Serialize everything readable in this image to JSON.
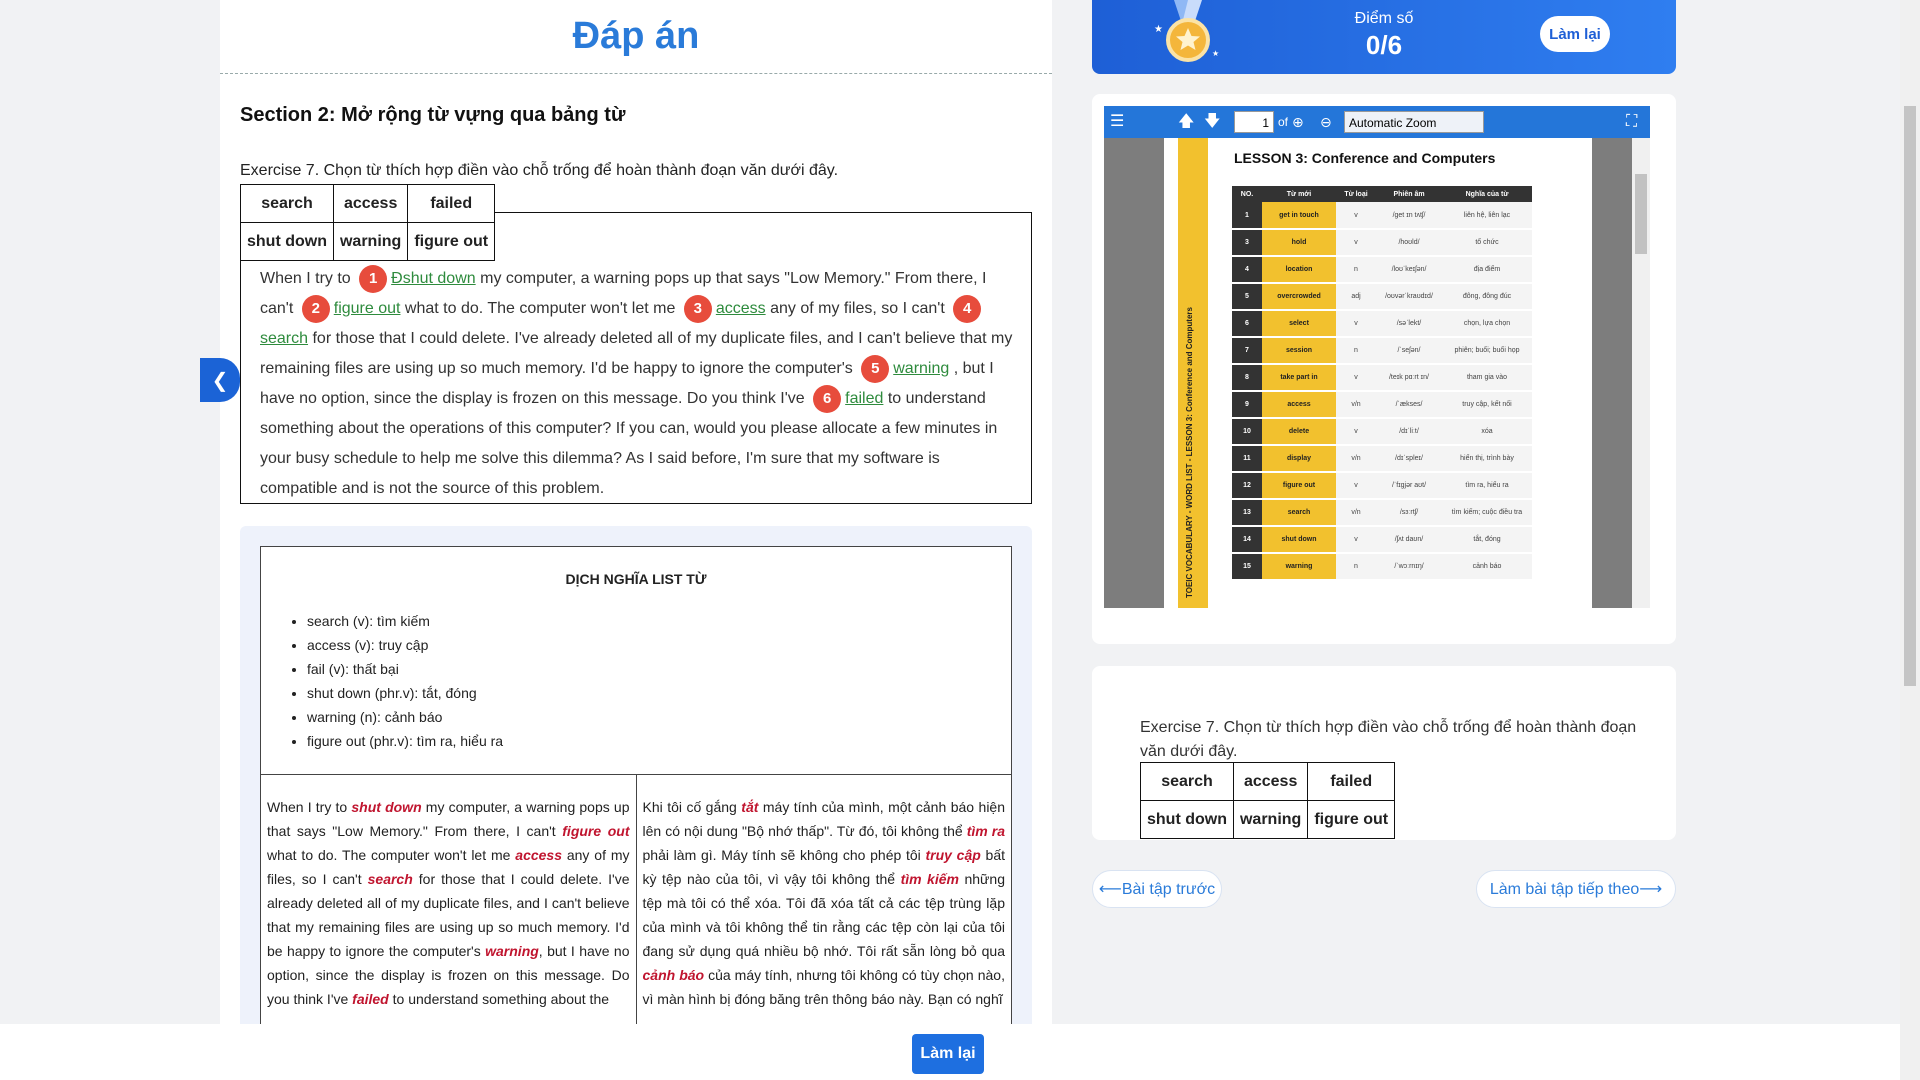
{
  "answer_title": "Đáp án",
  "section_title": "Section 2: Mở rộng từ vựng qua bảng từ",
  "exercise_title": "Exercise 7. Chọn từ thích hợp điền vào chỗ trống để hoàn thành đoạn văn dưới đây.",
  "word_bank": [
    [
      "search",
      "access",
      "failed"
    ],
    [
      "shut down",
      "warning",
      "figure out"
    ]
  ],
  "passage": {
    "p0": "When I try to",
    "n1": "1",
    "a1": "Đshut down",
    "p1": "my computer, a warning pops up that says \"Low Memory.\" From there, I can't",
    "n2": "2",
    "a2": "figure out",
    "p2": "what to do. The computer won't let me",
    "n3": "3",
    "a3": "access",
    "p3": "any of my files, so I can't",
    "n4": "4",
    "a4": "search",
    "p4": "for those that I could delete. I've already deleted all of my duplicate files, and I can't believe that my remaining files are using up so much memory. I'd be happy to ignore the computer's",
    "n5": "5",
    "a5": "warning",
    "p5": ", but I have no option, since the display is frozen on this message. Do you think I've",
    "n6": "6",
    "a6": "failed",
    "p6": "to understand something about the operations of this computer? If you can, would you please allocate a few minutes in your busy schedule to help me solve this dilemma? As I said before, I'm sure that my software is compatible and is not the source of this problem."
  },
  "translation": {
    "title": "DỊCH NGHĨA LIST TỪ",
    "vocab": [
      "search (v): tìm kiếm",
      "access (v): truy cập",
      "fail (v): thất bại",
      "shut down (phr.v): tắt, đóng",
      "warning (n): cảnh báo",
      "figure out (phr.v): tìm ra, hiểu ra"
    ],
    "en": {
      "t0": "When I try to ",
      "k0": "shut down",
      "t1": " my computer, a warning pops up that says \"Low Memory.\" From there, I can't ",
      "k1": "figure out",
      "t2": " what to do. The computer won't let me ",
      "k2": "access",
      "t3": " any of my files, so I can't ",
      "k3": "search",
      "t4": " for those that I could delete. I've already deleted  all of my duplicate files, and I can't believe that my remaining files are using up so much memory. I'd be happy to ignore the computer's ",
      "k4": "warning",
      "t5": ", but I have no option, since the display  is frozen on this message. Do you think I've ",
      "k5": "failed",
      "t6": " to understand something about the"
    },
    "vi": {
      "t0": "Khi tôi cố gắng ",
      "k0": "tắt",
      "t1": " máy tính của mình, một cảnh báo hiện lên có nội dung \"Bộ nhớ thấp\". Từ đó, tôi không thể ",
      "k1": "tìm ra",
      "t2": " phải làm gì. Máy tính sẽ không cho phép tôi ",
      "k2": "truy cập",
      "t3": " bất kỳ tệp nào của tôi, vì vậy tôi không thể ",
      "k3": "tìm kiếm",
      "t4": " những tệp mà tôi có thể xóa. Tôi đã xóa tất cả các tệp trùng lặp của mình và tôi không thể tin rằng các tệp còn lại của tôi đang sử dụng quá nhiều bộ nhớ. Tôi rất sẵn lòng bỏ qua ",
      "k4": "cảnh báo",
      "t5": " của máy tính, nhưng tôi không có tùy chọn nào, vì màn hình bị đóng băng trên thông báo này. Bạn có nghĩ"
    }
  },
  "score": {
    "label": "Điểm số",
    "value": "0/6",
    "retry": "Làm lại"
  },
  "pdf": {
    "page": "1",
    "of": "of",
    "zoom": "Automatic Zoom",
    "lesson_title": "LESSON 3: Conference and Computers",
    "side_label": "TOEIC VOCABULARY - WORD LIST - LESSON 3: Conference and Computers",
    "headers": [
      "NO.",
      "Từ mới",
      "Từ loại",
      "Phiên âm",
      "Nghĩa của từ"
    ],
    "rows": [
      [
        "1",
        "get in touch",
        "v",
        "/ɡet ɪn tʌtʃ/",
        "liên hệ, liên lạc"
      ],
      [
        "3",
        "hold",
        "v",
        "/hoʊld/",
        "tổ chức"
      ],
      [
        "4",
        "location",
        "n",
        "/loʊˈkeɪʃən/",
        "địa điểm"
      ],
      [
        "5",
        "overcrowded",
        "adj",
        "/oʊvərˈkraʊdɪd/",
        "đông, đông đúc"
      ],
      [
        "6",
        "select",
        "v",
        "/səˈlekt/",
        "chọn, lựa chọn"
      ],
      [
        "7",
        "session",
        "n",
        "/ˈseʃən/",
        "phiên; buổi; buổi họp"
      ],
      [
        "8",
        "take part in",
        "v",
        "/teɪk pɑːrt ɪn/",
        "tham gia vào"
      ],
      [
        "9",
        "access",
        "v/n",
        "/ˈækses/",
        "truy cập, kết nối"
      ],
      [
        "10",
        "delete",
        "v",
        "/dɪˈliːt/",
        "xóa"
      ],
      [
        "11",
        "display",
        "v/n",
        "/dɪˈspleɪ/",
        "hiển thị, trình bày"
      ],
      [
        "12",
        "figure out",
        "v",
        "/ˈfɪɡjər aʊt/",
        "tìm ra, hiểu ra"
      ],
      [
        "13",
        "search",
        "v/n",
        "/sɜːrtʃ/",
        "tìm kiếm; cuộc điều tra"
      ],
      [
        "14",
        "shut down",
        "v",
        "/ʃʌt daʊn/",
        "tắt, đóng"
      ],
      [
        "15",
        "warning",
        "n",
        "/ˈwɔːrnɪŋ/",
        "cảnh báo"
      ]
    ]
  },
  "question": {
    "text": "Exercise 7. Chọn từ thích hợp điền vào chỗ trống để hoàn thành đoạn văn dưới đây."
  },
  "nav": {
    "prev": "⟵Bài tập trước",
    "next": "Làm bài tập tiếp theo⟶"
  },
  "footer": {
    "retry": "Làm lại"
  },
  "icons": {
    "back": "chevron-left-icon",
    "menu": "hamburger-icon",
    "fullscreen": "expand-icon",
    "medal": "medal-icon"
  },
  "colors": {
    "primary": "#1e6fe0",
    "title": "#2a7bd9",
    "answer": "#2e8b3d",
    "badge": "#e74c3c",
    "keyword": "#c0152f",
    "pdf_yellow": "#f2c12e"
  }
}
